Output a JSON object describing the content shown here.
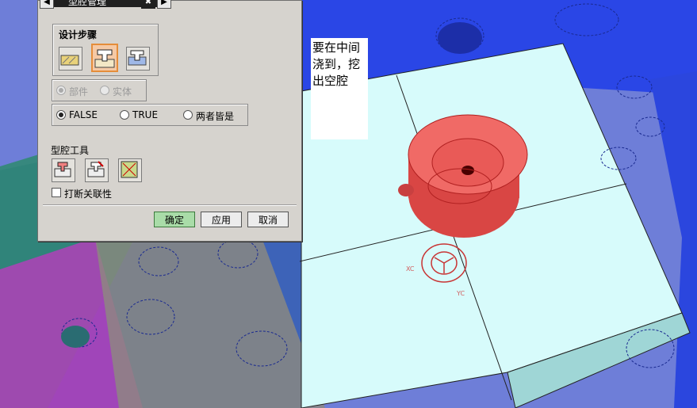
{
  "dialog": {
    "title": "型腔管理",
    "design_steps_label": "设计步骤",
    "body_type_options": [
      {
        "label": "部件",
        "selected": true,
        "enabled": false
      },
      {
        "label": "实体",
        "selected": false,
        "enabled": false
      }
    ],
    "mode_options": [
      {
        "label": "FALSE",
        "selected": true
      },
      {
        "label": "TRUE",
        "selected": false
      },
      {
        "label": "两者皆是",
        "selected": false
      }
    ],
    "cavity_tools_label": "型腔工具",
    "break_associativity_label": "打断关联性",
    "break_associativity_checked": false,
    "ok_label": "确定",
    "apply_label": "应用",
    "cancel_label": "取消"
  },
  "note": {
    "text": "要在中间浇到，挖出空腔"
  },
  "viewport": {
    "axis_x_label": "XC",
    "axis_y_label": "YC"
  },
  "colors": {
    "dialog_bg": "#d6d3ce",
    "selected_step": "#f5c9a5",
    "primary_button": "#a9dca8",
    "part_red": "#e8504e",
    "plate_cyan": "#d8fbfb",
    "plate_blue": "#2a3fd0"
  }
}
